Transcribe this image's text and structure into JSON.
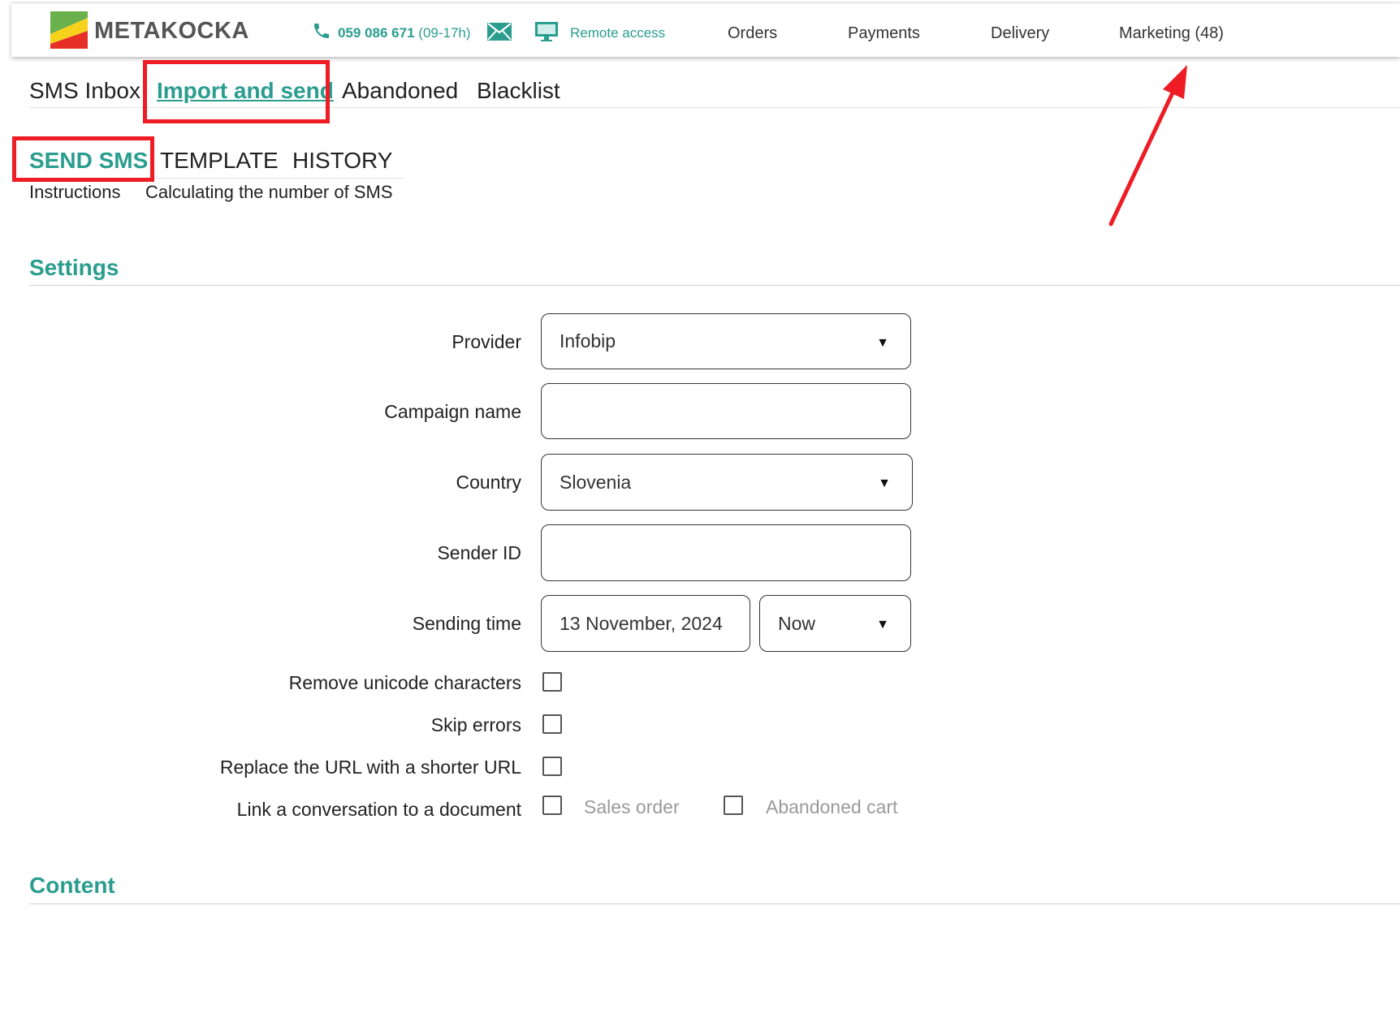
{
  "topbar": {
    "logo_text": "METAKOCKA",
    "phone": "059 086 671",
    "phone_hours": "(09-17h)",
    "remote_access": "Remote access",
    "nav": [
      "Orders",
      "Payments",
      "Delivery",
      "Marketing (48)"
    ]
  },
  "tabs": [
    "SMS Inbox",
    "Import and send",
    "Abandoned",
    "Blacklist"
  ],
  "subtabs": [
    "SEND SMS",
    "TEMPLATE",
    "HISTORY"
  ],
  "sublinks": [
    "Instructions",
    "Calculating the number of SMS"
  ],
  "settings": {
    "title": "Settings",
    "provider": {
      "label": "Provider",
      "value": "Infobip"
    },
    "campaign_name": {
      "label": "Campaign name",
      "value": ""
    },
    "country": {
      "label": "Country",
      "value": "Slovenia"
    },
    "sender_id": {
      "label": "Sender ID",
      "value": ""
    },
    "sending_time": {
      "label": "Sending time",
      "date": "13 November, 2024",
      "mode": "Now"
    },
    "remove_unicode": {
      "label": "Remove unicode characters",
      "checked": false
    },
    "skip_errors": {
      "label": "Skip errors",
      "checked": false
    },
    "shorten_url": {
      "label": "Replace the URL with a shorter URL",
      "checked": false
    },
    "link_conversation": {
      "label": "Link a conversation to a document",
      "options": [
        "Sales order",
        "Abandoned cart"
      ]
    }
  },
  "content": {
    "title": "Content"
  },
  "colors": {
    "accent": "#2a9d8f",
    "highlight": "#ee1c24"
  },
  "icons": [
    "phone-icon",
    "mail-icon",
    "monitor-icon",
    "chevron-down-icon"
  ]
}
